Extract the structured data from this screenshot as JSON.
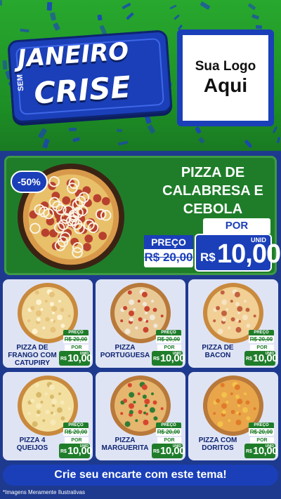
{
  "header": {
    "title_line1": "JANEIRO",
    "title_sem": "SEM",
    "title_line2": "CRISE",
    "logo_line1": "Sua Logo",
    "logo_line2": "Aqui"
  },
  "featured": {
    "discount": "-50%",
    "name": "PIZZA DE CALABRESA E CEBOLA",
    "por_label": "POR",
    "preco_label": "PREÇO",
    "old_price": "R$ 20,00",
    "unid_label": "UNID",
    "currency": "R$",
    "price": "10,00"
  },
  "price_labels": {
    "preco": "PREÇO",
    "por": "POR",
    "unid": "UNID",
    "currency": "R$"
  },
  "products": [
    {
      "name": "PIZZA DE FRANGO COM CATUPIRY",
      "old_price": "R$ 20,00",
      "price": "10,00",
      "icon": "pizza-frango-icon"
    },
    {
      "name": "PIZZA PORTUGUESA",
      "old_price": "R$ 20,00",
      "price": "10,00",
      "icon": "pizza-portuguesa-icon"
    },
    {
      "name": "PIZZA DE BACON",
      "old_price": "R$ 20,00",
      "price": "10,00",
      "icon": "pizza-bacon-icon"
    },
    {
      "name": "PIZZA 4 QUEIJOS",
      "old_price": "R$ 20,00",
      "price": "10,00",
      "icon": "pizza-queijos-icon"
    },
    {
      "name": "PIZZA MARGUERITA",
      "old_price": "R$ 20,00",
      "price": "10,00",
      "icon": "pizza-marguerita-icon"
    },
    {
      "name": "PIZZA COM DORITOS",
      "old_price": "R$ 20,00",
      "price": "10,00",
      "icon": "pizza-doritos-icon"
    }
  ],
  "footer": {
    "cta": "Crie seu encarte com este tema!",
    "disclaimer": "*Imagens Meramente Ilustrativas"
  },
  "colors": {
    "green": "#1f7d2a",
    "blue": "#1a3fb8",
    "card_bg": "#dfe4f5"
  }
}
